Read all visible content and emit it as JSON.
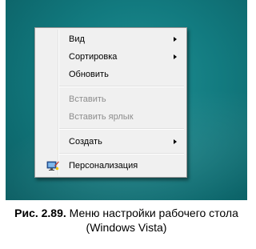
{
  "menu": {
    "items": [
      {
        "label": "Вид",
        "has_submenu": true,
        "enabled": true
      },
      {
        "label": "Сортировка",
        "has_submenu": true,
        "enabled": true
      },
      {
        "label": "Обновить",
        "has_submenu": false,
        "enabled": true
      },
      {
        "label": "Вставить",
        "has_submenu": false,
        "enabled": false
      },
      {
        "label": "Вставить ярлык",
        "has_submenu": false,
        "enabled": false
      },
      {
        "label": "Создать",
        "has_submenu": true,
        "enabled": true
      },
      {
        "label": "Персонализация",
        "has_submenu": false,
        "enabled": true,
        "icon": "personalize-icon"
      }
    ]
  },
  "caption": {
    "number": "Рис. 2.89.",
    "line1": " Меню настройки рабочего стола",
    "line2": "(Windows Vista)"
  },
  "colors": {
    "desktop": "#127a7f",
    "menu_background": "#f0f0f0",
    "disabled_text": "#8d8d8d"
  }
}
